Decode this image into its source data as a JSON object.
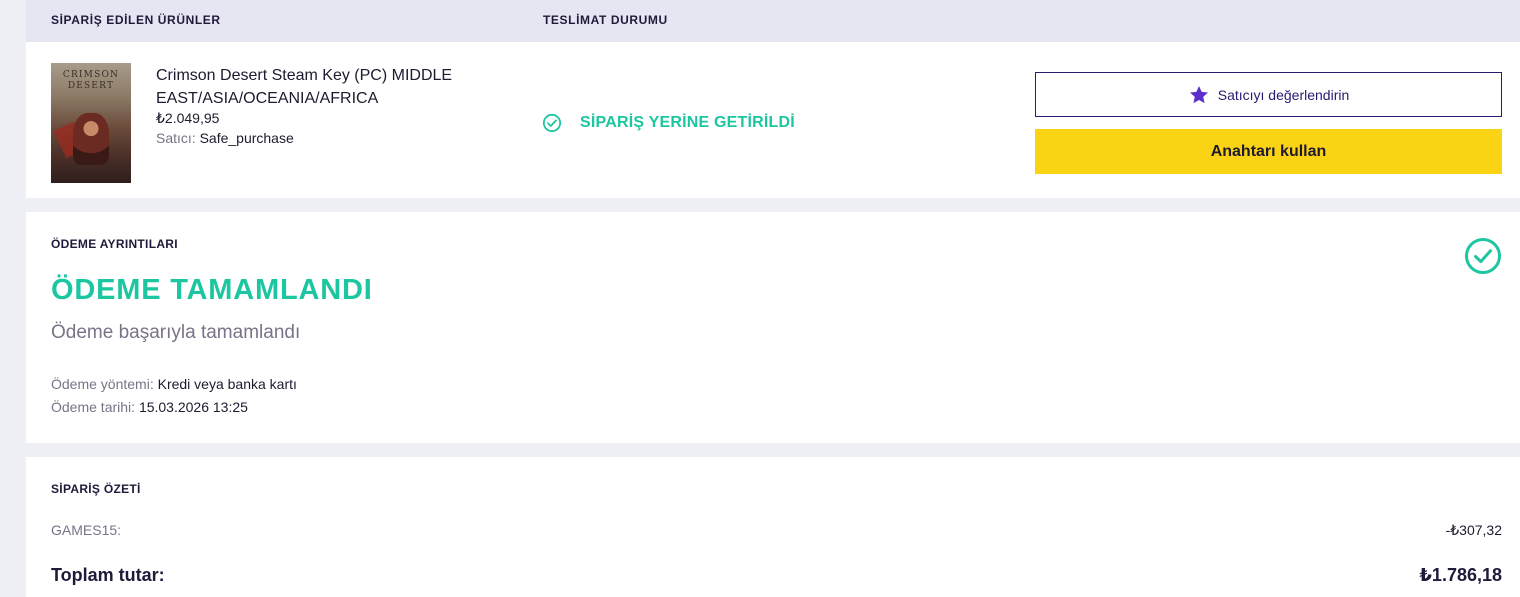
{
  "orders": {
    "header": {
      "products_label": "SİPARİŞ EDİLEN ÜRÜNLER",
      "delivery_label": "TESLİMAT DURUMU"
    },
    "item": {
      "thumbnail_title_line1": "CRIMSON",
      "thumbnail_title_line2": "DESERT",
      "name": "Crimson Desert Steam Key (PC) MIDDLE EAST/ASIA/OCEANIA/AFRICA",
      "price": "₺2.049,95",
      "seller_label": "Satıcı:",
      "seller_name": "Safe_purchase",
      "delivery_status": "SİPARİŞ YERİNE GETİRİLDİ",
      "rate_seller_label": "Satıcıyı değerlendirin",
      "use_key_label": "Anahtarı kullan"
    }
  },
  "payment": {
    "title": "ÖDEME AYRINTILARI",
    "status": "ÖDEME TAMAMLANDI",
    "subtitle": "Ödeme başarıyla tamamlandı",
    "method_label": "Ödeme yöntemi:",
    "method_value": "Kredi veya banka kartı",
    "date_label": "Ödeme tarihi:",
    "date_value": "15.03.2026 13:25"
  },
  "summary": {
    "title": "SİPARİŞ ÖZETİ",
    "discount_code": "GAMES15:",
    "discount_value": "-₺307,32",
    "total_label": "Toplam tutar:",
    "total_value": "₺1.786,18"
  },
  "colors": {
    "success": "#1cc6a0",
    "accent_purple": "#5b2fc9",
    "button_yellow": "#fad315",
    "dark_navy": "#1f1a3a"
  },
  "icons": {
    "delivery": "check-circle-icon",
    "rate": "star-icon",
    "payment": "check-circle-icon"
  }
}
